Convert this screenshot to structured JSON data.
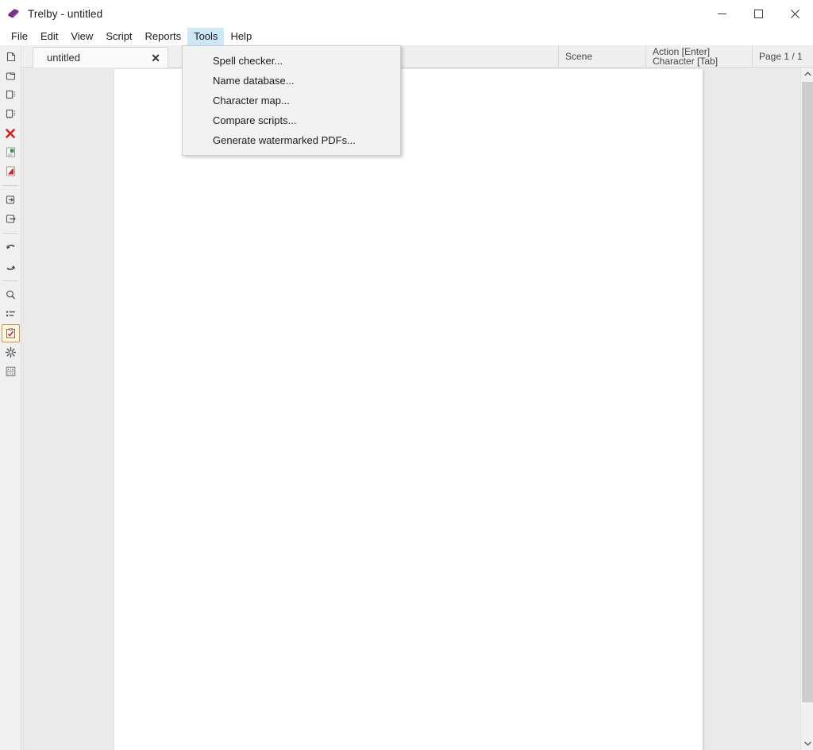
{
  "window": {
    "title": "Trelby - untitled",
    "logo_icon": "trelby-logo-icon",
    "controls": {
      "minimize": "minimize-icon",
      "maximize": "maximize-icon",
      "close": "close-icon"
    }
  },
  "menubar": {
    "items": [
      {
        "label": "File",
        "active": false
      },
      {
        "label": "Edit",
        "active": false
      },
      {
        "label": "View",
        "active": false
      },
      {
        "label": "Script",
        "active": false
      },
      {
        "label": "Reports",
        "active": false
      },
      {
        "label": "Tools",
        "active": true
      },
      {
        "label": "Help",
        "active": false
      }
    ],
    "highlight_color": "#cde8f7"
  },
  "dropdown": {
    "owner": "Tools",
    "items": [
      {
        "label": "Spell checker..."
      },
      {
        "label": "Name database..."
      },
      {
        "label": "Character map..."
      },
      {
        "label": "Compare scripts..."
      },
      {
        "label": "Generate watermarked PDFs..."
      }
    ]
  },
  "toolbar": {
    "items": [
      {
        "icon": "new-script-icon",
        "selected": false,
        "separator_after": false
      },
      {
        "icon": "open-script-icon",
        "selected": false,
        "separator_after": false
      },
      {
        "icon": "save-script-icon",
        "selected": false,
        "separator_after": false
      },
      {
        "icon": "save-as-script-icon",
        "selected": false,
        "separator_after": false
      },
      {
        "icon": "close-script-icon",
        "selected": false,
        "separator_after": false
      },
      {
        "icon": "export-html-icon",
        "selected": false,
        "separator_after": false
      },
      {
        "icon": "export-pdf-icon",
        "selected": false,
        "separator_after": true
      },
      {
        "icon": "import-icon",
        "selected": false,
        "separator_after": false
      },
      {
        "icon": "export-icon",
        "selected": false,
        "separator_after": true
      },
      {
        "icon": "undo-icon",
        "selected": false,
        "separator_after": false
      },
      {
        "icon": "redo-icon",
        "selected": false,
        "separator_after": true
      },
      {
        "icon": "find-icon",
        "selected": false,
        "separator_after": false
      },
      {
        "icon": "scene-list-icon",
        "selected": false,
        "separator_after": false
      },
      {
        "icon": "spell-check-icon",
        "selected": true,
        "separator_after": false
      },
      {
        "icon": "settings-icon",
        "selected": false,
        "separator_after": false
      },
      {
        "icon": "character-map-icon",
        "selected": false,
        "separator_after": false
      }
    ],
    "selected_highlight_color": "#fdf4e3",
    "selected_border_color": "#c89b4a"
  },
  "tabs": {
    "items": [
      {
        "label": "untitled",
        "close_icon": "close-tab-icon",
        "active": true
      }
    ]
  },
  "status": {
    "element_type": "Scene",
    "format_hint_line1": "Action [Enter]",
    "format_hint_line2": "Character [Tab]",
    "page_indicator": "Page 1 / 1"
  },
  "script": {
    "content": "",
    "page_background": "#ffffff",
    "workspace_background": "#eaeaea"
  },
  "scrollbar": {
    "up_icon": "scroll-up-icon",
    "down_icon": "scroll-down-icon",
    "thumb": "scroll-thumb"
  }
}
